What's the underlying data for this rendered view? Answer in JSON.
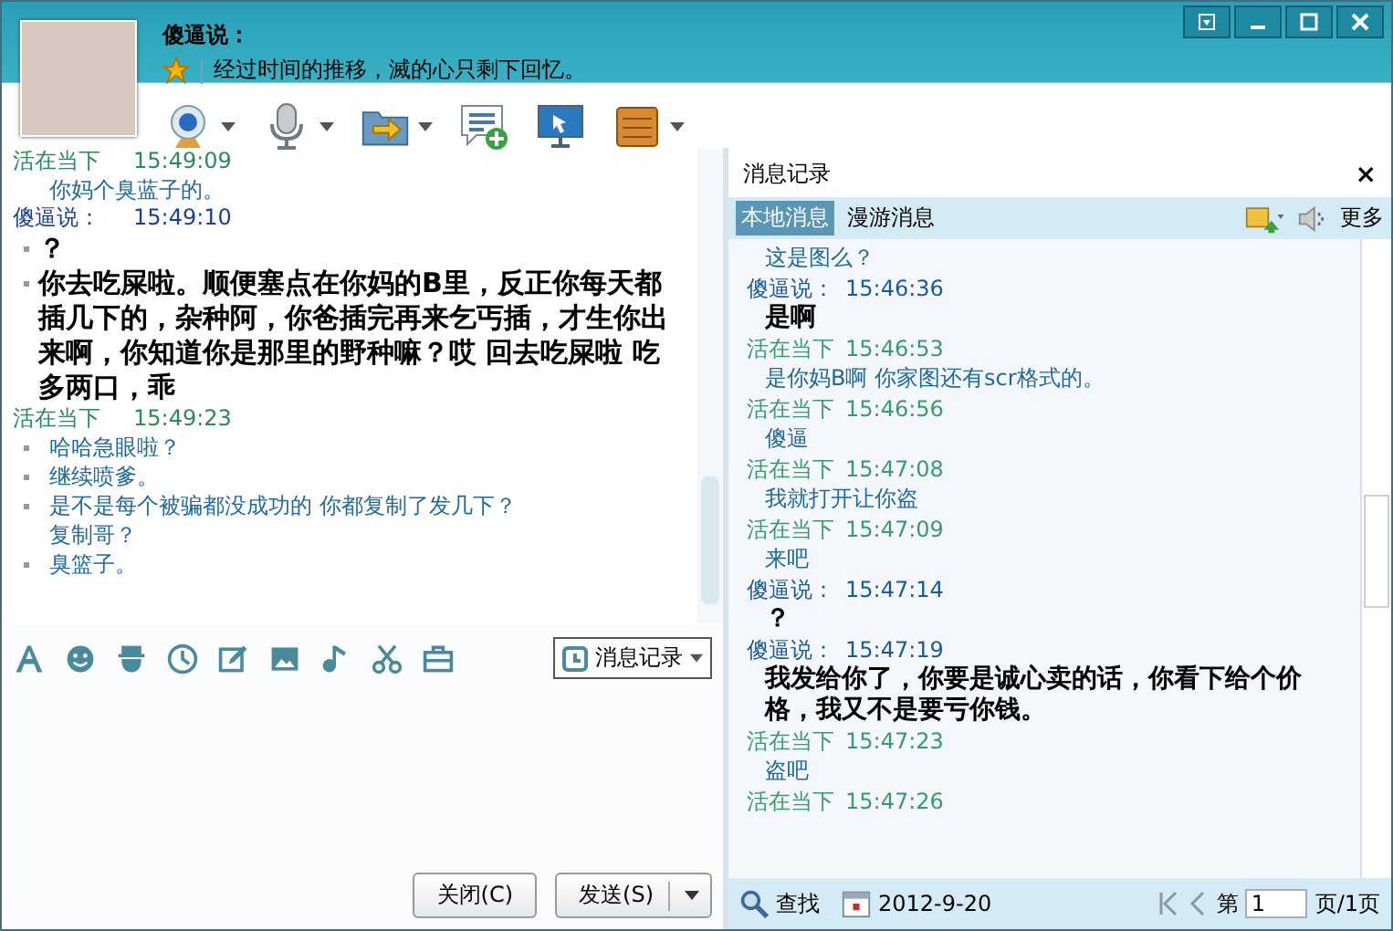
{
  "header": {
    "name": "傻逼说：",
    "signature": "经过时间的推移，滅的心只剩下回忆。"
  },
  "window_buttons": [
    {
      "kind": "menu"
    },
    {
      "kind": "minimize"
    },
    {
      "kind": "maximize"
    },
    {
      "kind": "close"
    }
  ],
  "toolbar": [
    {
      "kind": "webcam",
      "dropdown": true
    },
    {
      "kind": "mic",
      "dropdown": true
    },
    {
      "kind": "transfer",
      "dropdown": true
    },
    {
      "kind": "note",
      "dropdown": false
    },
    {
      "kind": "screen",
      "dropdown": false
    },
    {
      "kind": "app",
      "dropdown": true
    }
  ],
  "chat": [
    {
      "kind": "peer",
      "sender": "活在当下",
      "time": "15:49:09",
      "lines": [
        {
          "text": "你妈个臭蓝子的。",
          "bullet": false
        }
      ]
    },
    {
      "kind": "self",
      "sender": "傻逼说：",
      "time": "15:49:10",
      "lines": [
        {
          "text": "？",
          "bullet": true
        },
        {
          "text": "你去吃屎啦。顺便塞点在你妈的B里，反正你每天都插几下的，杂种阿，你爸插完再来乞丐插，才生你出来啊，你知道你是那里的野种嘛？哎  回去吃屎啦  吃多两口，乖",
          "bullet": true
        }
      ]
    },
    {
      "kind": "peer",
      "sender": "活在当下",
      "time": "15:49:23",
      "lines": [
        {
          "text": "哈哈急眼啦？",
          "bullet": true
        },
        {
          "text": "继续喷爹。",
          "bullet": true
        },
        {
          "text": "是不是每个被骗都没成功的 你都复制了发几下？",
          "bullet": true
        },
        {
          "text": "复制哥？",
          "bullet": false
        },
        {
          "text": "臭篮子。",
          "bullet": true
        }
      ]
    }
  ],
  "input_toolbar": [
    {
      "kind": "font"
    },
    {
      "kind": "smiley"
    },
    {
      "kind": "hat-face"
    },
    {
      "kind": "clock-face"
    },
    {
      "kind": "edit"
    },
    {
      "kind": "image"
    },
    {
      "kind": "music"
    },
    {
      "kind": "scissors"
    },
    {
      "kind": "briefcase"
    }
  ],
  "history_button": "消息记录",
  "buttons": [
    {
      "label": "关闭(C)",
      "dropdown": false
    },
    {
      "label": "发送(S)",
      "dropdown": true
    }
  ],
  "history": {
    "title": "消息记录",
    "close": "×",
    "tabs": [
      {
        "label": "本地消息",
        "selected": true
      },
      {
        "label": "漫游消息",
        "selected": false
      }
    ],
    "more": "更多",
    "messages": [
      {
        "kind": "peer",
        "text": "这是图么？"
      },
      {
        "kind": "self",
        "sender": "傻逼说：",
        "time": "15:46:36",
        "text": "是啊"
      },
      {
        "kind": "peer",
        "sender": "活在当下",
        "time": "15:46:53",
        "text": "是你妈B啊 你家图还有scr格式的。"
      },
      {
        "kind": "peer",
        "sender": "活在当下",
        "time": "15:46:56",
        "text": "傻逼"
      },
      {
        "kind": "peer",
        "sender": "活在当下",
        "time": "15:47:08",
        "text": "我就打开让你盗"
      },
      {
        "kind": "peer",
        "sender": "活在当下",
        "time": "15:47:09",
        "text": "来吧"
      },
      {
        "kind": "self",
        "sender": "傻逼说：",
        "time": "15:47:14",
        "text": "？"
      },
      {
        "kind": "self",
        "sender": "傻逼说：",
        "time": "15:47:19",
        "text": "我发给你了，你要是诚心卖的话，你看下给个价格，我又不是要亏你钱。"
      },
      {
        "kind": "peer",
        "sender": "活在当下",
        "time": "15:47:23",
        "text": "盗吧"
      },
      {
        "kind": "peer",
        "sender": "活在当下",
        "time": "15:47:26"
      }
    ],
    "search": "查找",
    "date": "2012-9-20",
    "page_prefix": "第",
    "page": "1",
    "page_suffix": "页/1页"
  }
}
